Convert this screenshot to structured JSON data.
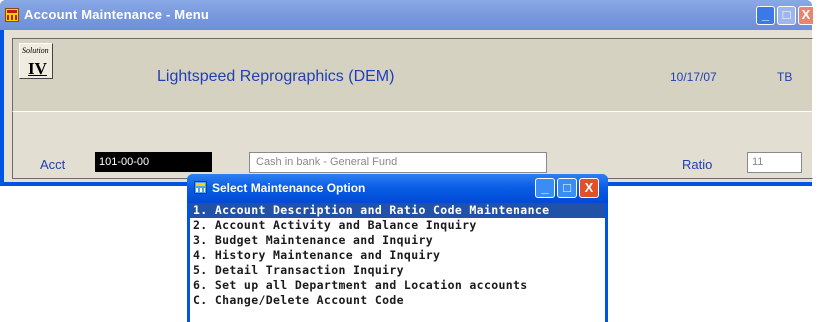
{
  "main_window": {
    "title": "Account Maintenance - Menu",
    "controls": {
      "minimize": "_",
      "maximize": "□",
      "close": "X"
    }
  },
  "header": {
    "logo_top": "Solution",
    "logo_bottom": "IV",
    "company": "Lightspeed Reprographics (DEM)",
    "date": "10/17/07",
    "user": "TB"
  },
  "account": {
    "acct_label": "Acct",
    "acct_value": "101-00-00",
    "description": "Cash in bank - General Fund",
    "ratio_label": "Ratio",
    "ratio_value": "11"
  },
  "dialog": {
    "title": "Select Maintenance Option",
    "controls": {
      "minimize": "_",
      "maximize": "□",
      "close": "X"
    },
    "items": [
      "1. Account Description and Ratio Code Maintenance",
      "2. Account Activity and Balance Inquiry",
      "3. Budget Maintenance and Inquiry",
      "4. History Maintenance and Inquiry",
      "5. Detail Transaction Inquiry",
      "6. Set up all Department and Location accounts",
      "C. Change/Delete Account Code"
    ],
    "selected_index": 0
  },
  "colors": {
    "title_inactive": "#7c9ce0",
    "title_active": "#0a5ee6",
    "label_blue": "#1f3fb4",
    "selection": "#2152a8"
  }
}
